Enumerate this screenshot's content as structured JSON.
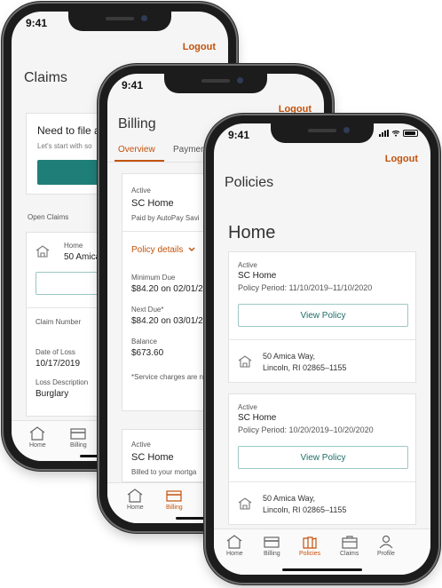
{
  "status_time": "9:41",
  "logout_label": "Logout",
  "colors": {
    "accent": "#c4520a",
    "teal": "#1f7f78"
  },
  "claims": {
    "title": "Claims",
    "file_heading": "Need to file a",
    "file_sub": "Let's start with so",
    "file_button": "R",
    "open_claims_label": "Open Claims",
    "item_title": "Home",
    "item_address": "50 Amica Wa",
    "claim_number_label": "Claim Number",
    "date_of_loss_label": "Date of Loss",
    "date_of_loss": "10/17/2019",
    "loss_description_label": "Loss Description",
    "loss_description": "Burglary",
    "tabs": [
      "Home",
      "Billing"
    ]
  },
  "billing": {
    "title": "Billing",
    "tabs": [
      "Overview",
      "Payment"
    ],
    "card1": {
      "status": "Active",
      "name": "SC Home",
      "paid_by": "Paid by AutoPay Savi",
      "policy_details": "Policy details",
      "minimum_due_label": "Minimum Due",
      "minimum_due": "$84.20 on 02/01/2",
      "next_due_label": "Next Due*",
      "next_due": "$84.20 on 03/01/2",
      "balance_label": "Balance",
      "balance": "$673.60",
      "note": "*Service charges are no"
    },
    "card2": {
      "status": "Active",
      "name": "SC Home",
      "billed": "Billed to your mortga"
    },
    "bottom_tabs": [
      "Home",
      "Billing",
      "P"
    ]
  },
  "policies": {
    "title": "Policies",
    "section_title": "Home",
    "cards": [
      {
        "status": "Active",
        "name": "SC Home",
        "period": "Policy Period: 11/10/2019–11/10/2020",
        "button": "View Policy",
        "address_line1": "50 Amica Way,",
        "address_line2": "Lincoln, RI 02865–1155"
      },
      {
        "status": "Active",
        "name": "SC Home",
        "period": "Policy Period: 10/20/2019–10/20/2020",
        "button": "View Policy",
        "address_line1": "50 Amica Way,",
        "address_line2": "Lincoln, RI 02865–1155"
      }
    ],
    "tabs": [
      "Home",
      "Billing",
      "Policies",
      "Claims",
      "Profile"
    ],
    "active_tab": "Policies"
  }
}
